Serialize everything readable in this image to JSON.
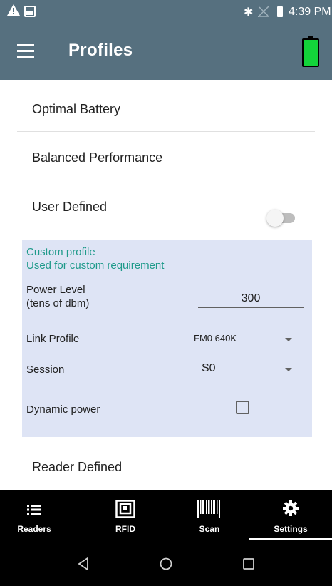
{
  "status_bar": {
    "time": "4:39 PM",
    "icons": [
      "warning-icon",
      "image-icon",
      "bluetooth-icon",
      "no-signal-icon",
      "battery-icon"
    ]
  },
  "app_bar": {
    "title": "Profiles",
    "menu_icon": "menu-icon",
    "battery_icon": "battery-full-icon",
    "battery_color": "#13d43a",
    "bar_color": "#56707f"
  },
  "profiles": [
    {
      "label": "Optimal Battery"
    },
    {
      "label": "Balanced Performance"
    },
    {
      "label": "User Defined"
    },
    {
      "label": "Reader Defined"
    }
  ],
  "user_defined_toggle": {
    "on": false
  },
  "custom_panel": {
    "title_line1": "Custom profile",
    "title_line2": "Used for custom requirement",
    "accent_color": "#1e9a8a",
    "panel_color": "#dee4f5",
    "power_label_line1": "Power Level",
    "power_label_line2": "(tens of dbm)",
    "power_value": "300",
    "link_profile_label": "Link Profile",
    "link_profile_value": "FM0 640K",
    "session_label": "Session",
    "session_value": "S0",
    "dynamic_power_label": "Dynamic power",
    "dynamic_power_checked": false
  },
  "bottom_nav": {
    "items": [
      {
        "label": "Readers",
        "icon": "list-icon"
      },
      {
        "label": "RFID",
        "icon": "rfid-icon"
      },
      {
        "label": "Scan",
        "icon": "barcode-icon"
      },
      {
        "label": "Settings",
        "icon": "gear-icon"
      }
    ],
    "active": "Settings"
  },
  "system_nav": {
    "icons": [
      "back-icon",
      "home-icon",
      "recents-icon"
    ]
  }
}
